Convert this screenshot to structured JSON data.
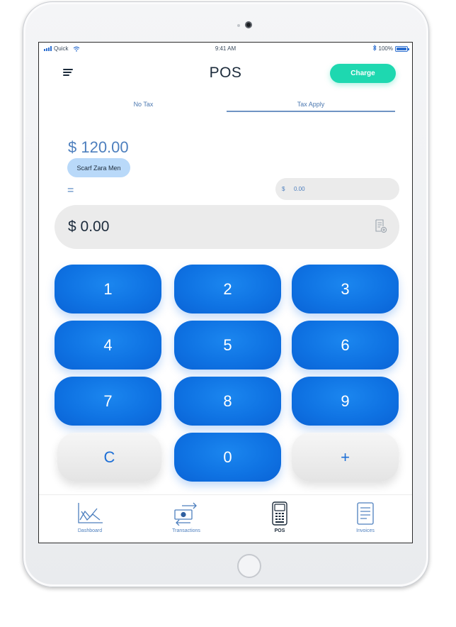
{
  "status_bar": {
    "carrier": "Quick",
    "time": "9:41 AM",
    "battery": "100%"
  },
  "header": {
    "title": "POS",
    "charge_label": "Charge"
  },
  "tabs": [
    {
      "label": "No Tax",
      "active": false
    },
    {
      "label": "Tax Apply",
      "active": true
    }
  ],
  "order": {
    "item_amount": "$ 120.00",
    "item_name": "Scarf Zara Men",
    "equals": "=",
    "tax_currency": "$",
    "tax_value": "0.00",
    "total": "$ 0.00"
  },
  "keypad": {
    "keys": [
      "1",
      "2",
      "3",
      "4",
      "5",
      "6",
      "7",
      "8",
      "9",
      "C",
      "0",
      "+"
    ]
  },
  "bottom_nav": [
    {
      "label": "Dashboard",
      "icon": "dashboard-chart-icon",
      "active": false
    },
    {
      "label": "Transactions",
      "icon": "transactions-exchange-icon",
      "active": false
    },
    {
      "label": "POS",
      "icon": "pos-terminal-icon",
      "active": true
    },
    {
      "label": "Invoices",
      "icon": "invoice-document-icon",
      "active": false
    }
  ],
  "colors": {
    "accent_blue": "#0f73e3",
    "charge_green": "#1ed8b0",
    "chip_blue": "#b9d9f9",
    "text_blue": "#4d7fbe"
  }
}
